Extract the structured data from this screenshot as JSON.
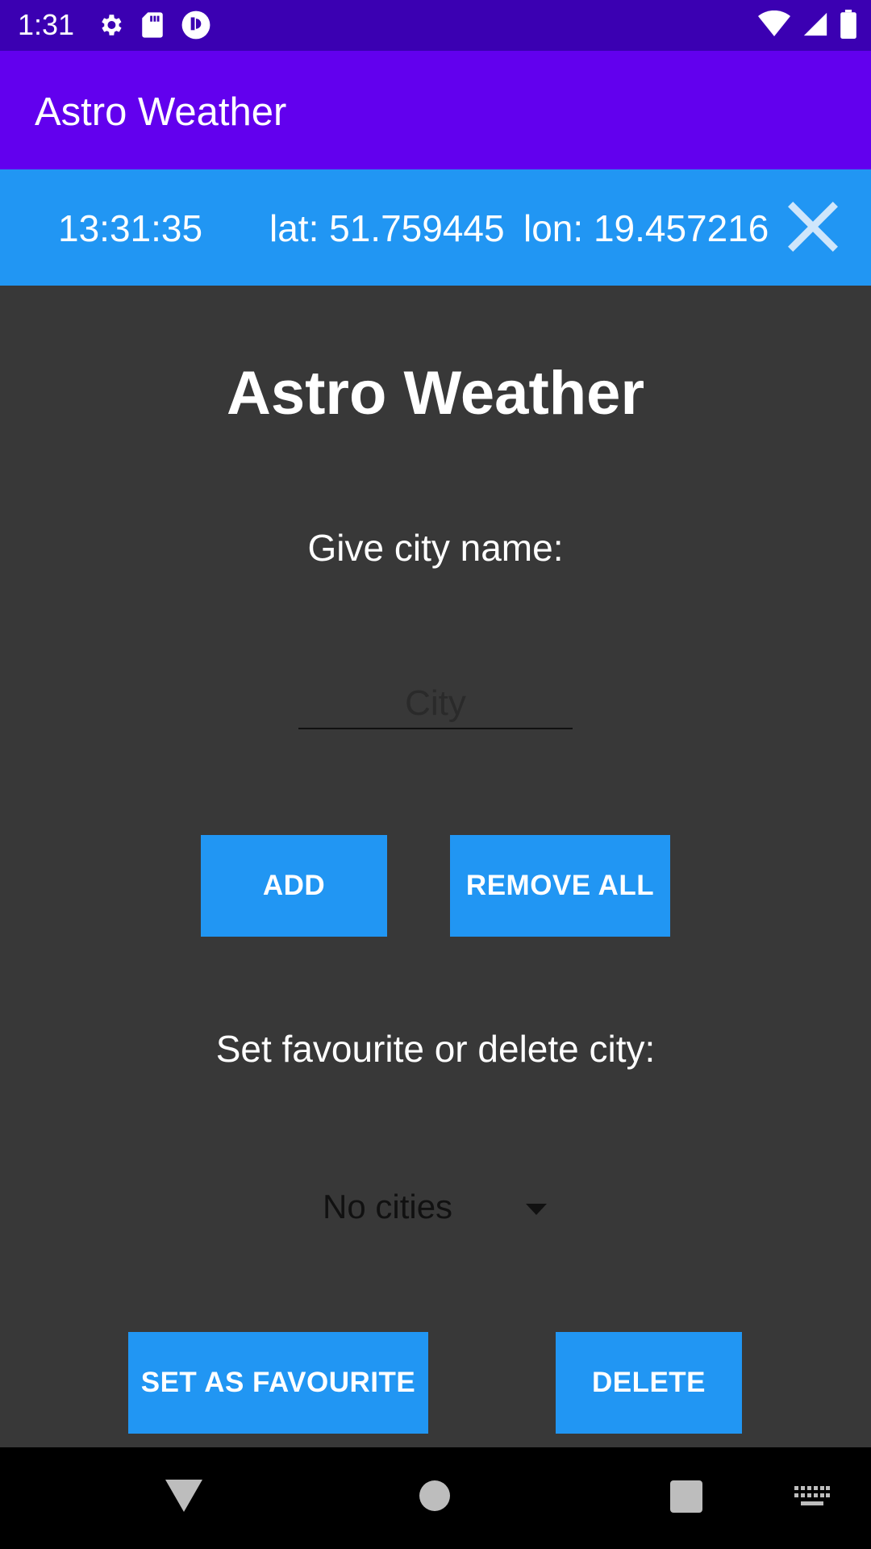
{
  "status_bar": {
    "time": "1:31",
    "icons": [
      "gear-icon",
      "sd-card-icon",
      "app-notification-icon",
      "wifi-icon",
      "signal-icon",
      "battery-icon"
    ]
  },
  "app_bar": {
    "title": "Astro Weather"
  },
  "info_bar": {
    "time": "13:31:35",
    "lat": "lat: 51.759445",
    "lon": "lon: 19.457216"
  },
  "main": {
    "heading": "Astro Weather",
    "city_prompt": "Give city name:",
    "city_input": {
      "value": "",
      "placeholder": "City"
    },
    "add_button": "ADD",
    "remove_all_button": "REMOVE ALL",
    "favourite_prompt": "Set favourite or delete city:",
    "city_spinner": {
      "selected": "No cities"
    },
    "set_favourite_button": "SET AS FAVOURITE",
    "delete_button": "DELETE"
  },
  "colors": {
    "status_bar": "#3b00b2",
    "app_bar": "#6200ee",
    "accent": "#2196f3",
    "background": "#383838"
  }
}
